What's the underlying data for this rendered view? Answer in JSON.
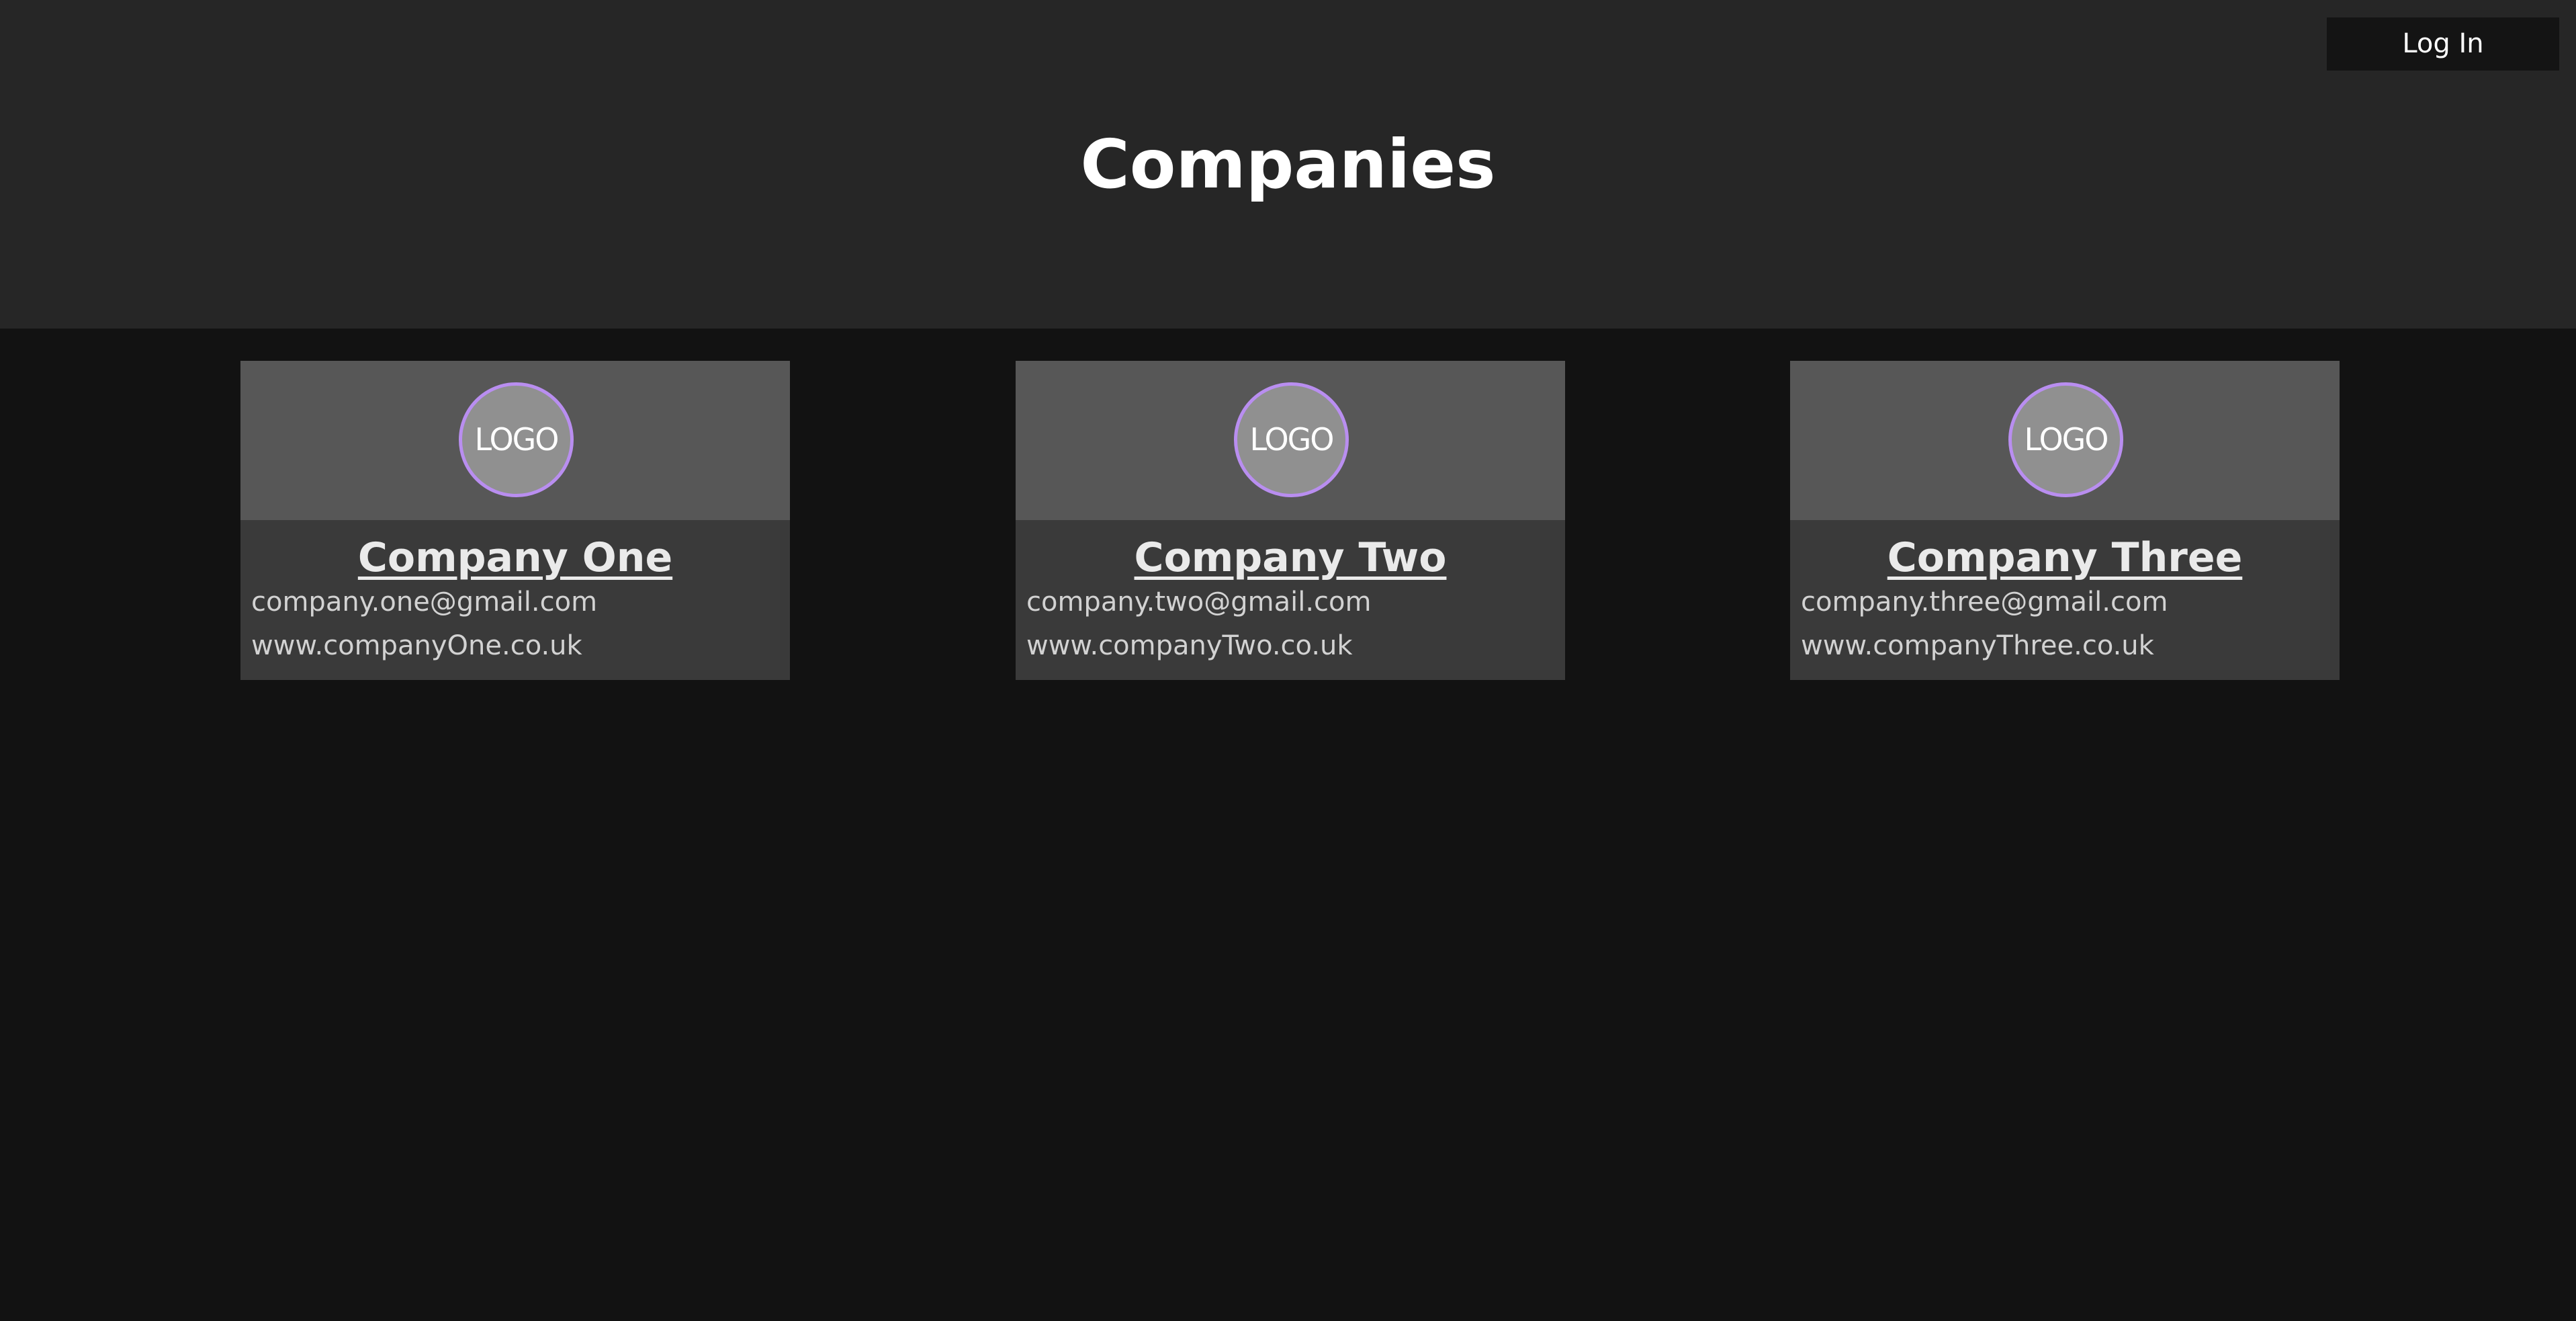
{
  "header": {
    "title": "Companies",
    "login_label": "Log In"
  },
  "companies": [
    {
      "logo_text": "LOGO",
      "name": "Company One",
      "email": "company.one@gmail.com",
      "website": "www.companyOne.co.uk"
    },
    {
      "logo_text": "LOGO",
      "name": "Company Two",
      "email": "company.two@gmail.com",
      "website": "www.companyTwo.co.uk"
    },
    {
      "logo_text": "LOGO",
      "name": "Company Three",
      "email": "company.three@gmail.com",
      "website": "www.companyThree.co.uk"
    }
  ],
  "colors": {
    "page_background": "#121212",
    "header_background": "#262626",
    "card_top_background": "#575757",
    "card_bottom_background": "#3a3a3a",
    "logo_border": "#b98ef0",
    "logo_fill": "#909090"
  }
}
